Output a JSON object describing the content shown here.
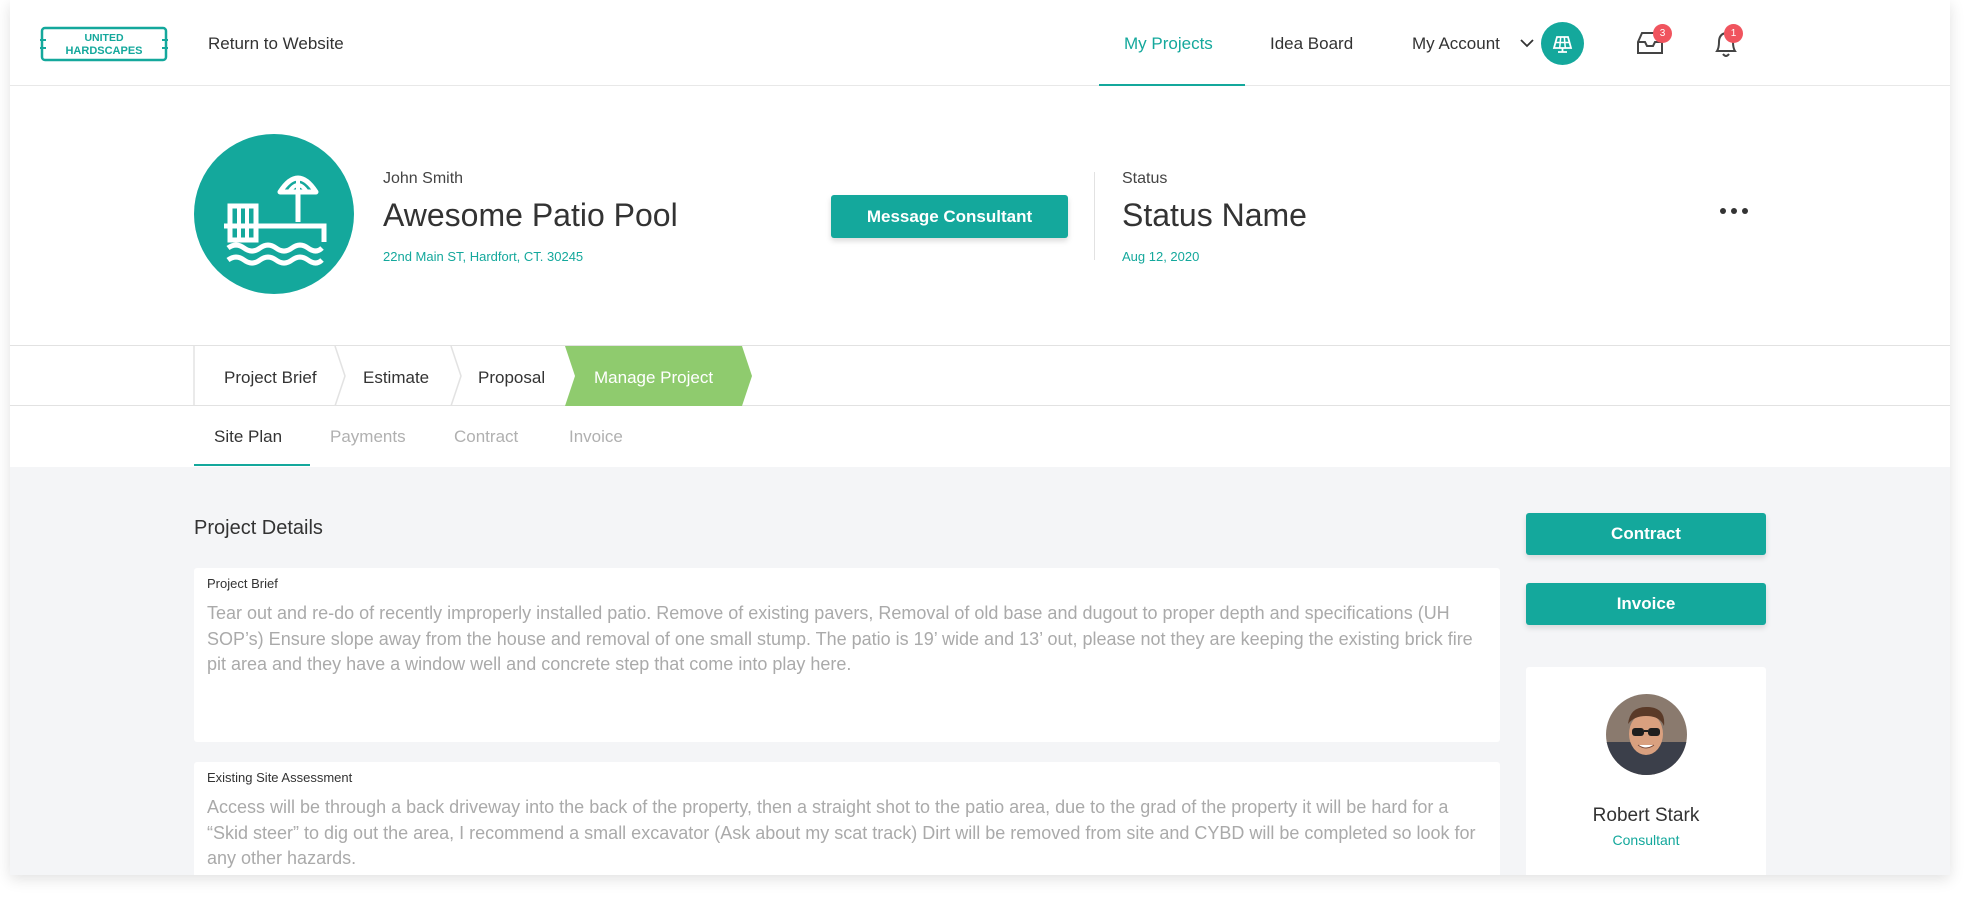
{
  "brand": {
    "logo_line1": "UNITED",
    "logo_line2": "HARDSCAPES",
    "accent": "#14a89c",
    "step_active": "#8fcb6e",
    "badge": "#f0545e"
  },
  "nav": {
    "return_link": "Return to Website",
    "my_projects": "My Projects",
    "idea_board": "Idea Board",
    "my_account": "My Account",
    "inbox_count": "3",
    "notification_count": "1",
    "icons": [
      "chevron-down-icon",
      "inbox-icon",
      "bell-icon"
    ]
  },
  "project": {
    "owner": "John Smith",
    "title": "Awesome Patio Pool",
    "address": "22nd Main ST, Hardfort, CT. 30245",
    "message_button": "Message Consultant",
    "status_label": "Status",
    "status_name": "Status Name",
    "status_date": "Aug 12, 2020"
  },
  "steps": [
    "Project Brief",
    "Estimate",
    "Proposal",
    "Manage Project"
  ],
  "active_step": "Manage Project",
  "tabs": [
    "Site Plan",
    "Payments",
    "Contract",
    "Invoice"
  ],
  "active_tab": "Site Plan",
  "details": {
    "heading": "Project Details",
    "brief_label": "Project Brief",
    "brief_text": "Tear out and re-do of recently improperly installed patio. Remove of existing pavers, Removal of old base and dugout to proper depth and specifications (UH SOP’s) Ensure slope away from the house and removal of one small stump. The patio is 19’ wide and 13’ out, please not they are keeping the existing brick fire pit area and they have a window well and concrete step that come into play here.",
    "site_label": "Existing Site Assessment",
    "site_text": "Access will be through a back driveway into the back of the property, then a straight shot to the patio area, due to the grad of the property it will be hard for a “Skid steer” to dig out the area, I recommend a small excavator (Ask about my scat track) Dirt will be removed from site and CYBD will be completed so look for any other hazards."
  },
  "sidebar": {
    "contract_button": "Contract",
    "invoice_button": "Invoice",
    "consultant_name": "Robert Stark",
    "consultant_role": "Consultant"
  }
}
